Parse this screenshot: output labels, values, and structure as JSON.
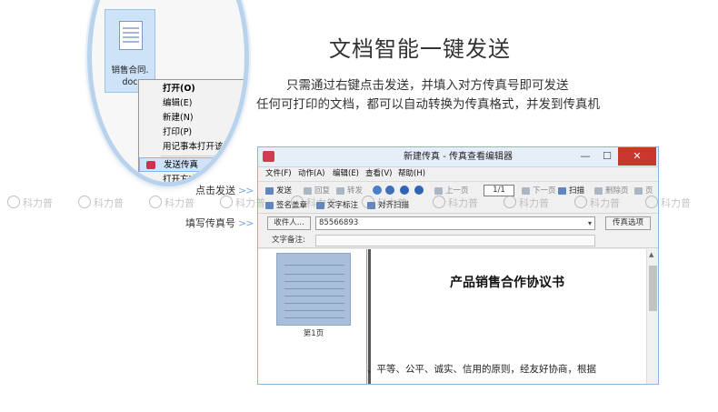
{
  "headline": "文档智能一键发送",
  "subline_1": "只需通过右键点击发送，并填入对方传真号即可发送",
  "subline_2": "任何可打印的文档，都可以自动转换为传真格式，并发到传真机",
  "file": {
    "name": "销售合同.",
    "ext": "doc"
  },
  "context_menu": {
    "items": [
      {
        "label": "打开(O)"
      },
      {
        "label": "编辑(E)"
      },
      {
        "label": "新建(N)"
      },
      {
        "label": "打印(P)"
      },
      {
        "label": "用记事本打开该文件"
      },
      {
        "label": "发送传真"
      },
      {
        "label": "打开方式(H)"
      }
    ]
  },
  "annotations": {
    "click_send": "点击发送",
    "fill_fax": "填写传真号",
    "arrow": ">>"
  },
  "window": {
    "title": "新建传真 - 传真查看编辑器",
    "controls": {
      "minimize": "—",
      "maximize": "☐",
      "close": "✕"
    },
    "menu": [
      "文件(F)",
      "动作(A)",
      "编辑(E)",
      "查看(V)",
      "帮助(H)"
    ],
    "toolbar_row1": {
      "send": "发送",
      "reply": "回复",
      "forward": "转发",
      "prev_page": "上一页",
      "page_indicator": "1/1",
      "next_page": "下一页",
      "scan": "扫描",
      "delete_page": "删除页",
      "page": "页"
    },
    "toolbar_row2": {
      "signature": "签名盖章",
      "text_note": "文字标注",
      "align_scan": "对齐扫描"
    },
    "recipient_button": "收件人...",
    "recipient_value": "85566893",
    "fax_options_button": "传真选项",
    "note_label": "文字备注:",
    "thumbnail_caption": "第1页",
    "document": {
      "title": "产品销售合作协议书",
      "body_excerpt": "、平等、公平、诚实、信用的原则，经友好协商，根据"
    }
  },
  "watermark": "科力普",
  "colors": {
    "accent_blue": "#7aa9e0",
    "close_red": "#c7382f",
    "highlight": "#cfe4fb"
  }
}
